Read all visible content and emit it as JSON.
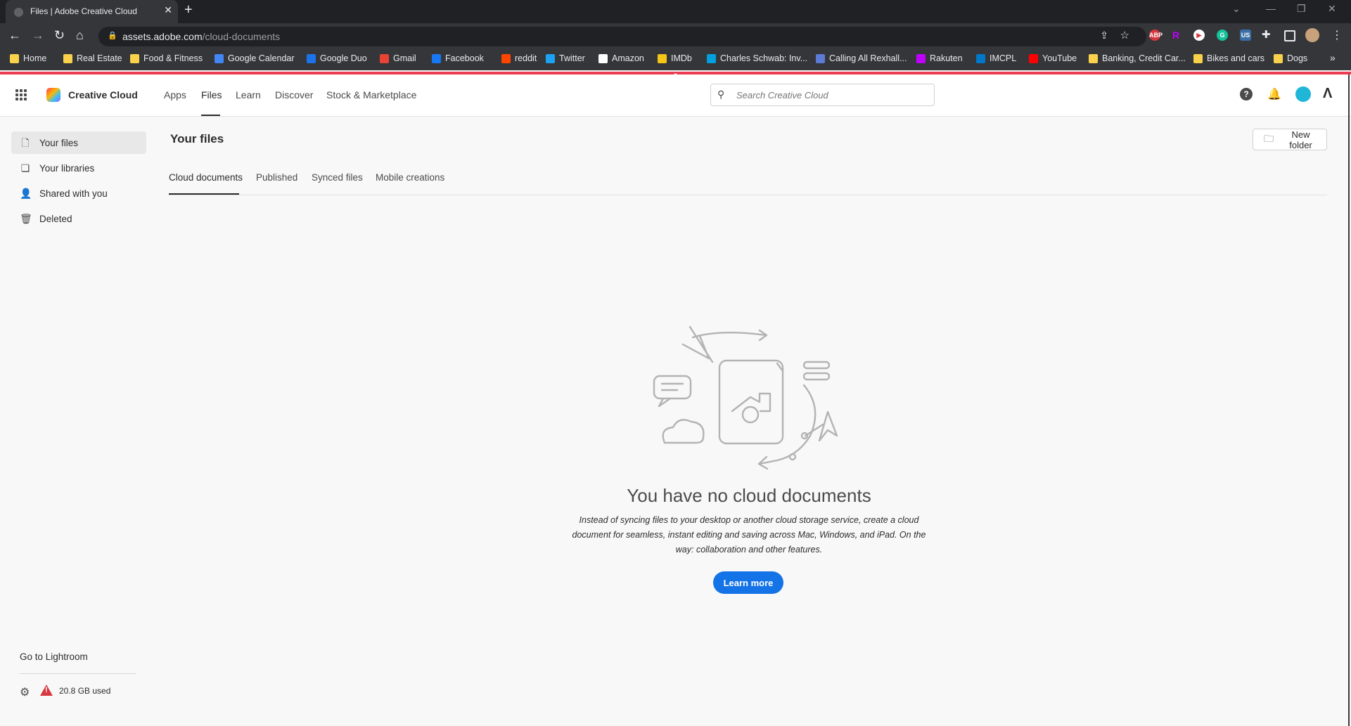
{
  "browser": {
    "tab_title": "Files | Adobe Creative Cloud",
    "url_host": "assets.adobe.com",
    "url_path": "/cloud-documents",
    "bookmarks": [
      {
        "label": "Home",
        "color": "#f9d14b"
      },
      {
        "label": "Real Estate",
        "color": "#f9d14b"
      },
      {
        "label": "Food & Fitness",
        "color": "#f9d14b"
      },
      {
        "label": "Google Calendar",
        "color": "#4285f4"
      },
      {
        "label": "Google Duo",
        "color": "#1a73e8"
      },
      {
        "label": "Gmail",
        "color": "#ea4335"
      },
      {
        "label": "Facebook",
        "color": "#1877f2"
      },
      {
        "label": "reddit",
        "color": "#ff4500"
      },
      {
        "label": "Twitter",
        "color": "#1da1f2"
      },
      {
        "label": "Amazon",
        "color": "#ffffff"
      },
      {
        "label": "IMDb",
        "color": "#f5c518"
      },
      {
        "label": "Charles Schwab: Inv...",
        "color": "#00a0df"
      },
      {
        "label": "Calling All Rexhall...",
        "color": "#5b7bd5"
      },
      {
        "label": "Rakuten",
        "color": "#bf00ff"
      },
      {
        "label": "IMCPL",
        "color": "#0077c8"
      },
      {
        "label": "YouTube",
        "color": "#ff0000"
      },
      {
        "label": "Banking, Credit Car...",
        "color": "#f9d14b"
      },
      {
        "label": "Bikes and cars",
        "color": "#f9d14b"
      },
      {
        "label": "Dogs",
        "color": "#f9d14b"
      }
    ]
  },
  "appbar": {
    "product": "Creative Cloud",
    "nav": [
      "Apps",
      "Files",
      "Learn",
      "Discover",
      "Stock & Marketplace"
    ],
    "active_nav": "Files",
    "search_placeholder": "Search Creative Cloud",
    "accent": "#eb3c52"
  },
  "sidebar": {
    "items": [
      {
        "label": "Your files",
        "icon": "file-icon",
        "selected": true
      },
      {
        "label": "Your libraries",
        "icon": "library-icon",
        "selected": false
      },
      {
        "label": "Shared with you",
        "icon": "people-icon",
        "selected": false
      },
      {
        "label": "Deleted",
        "icon": "trash-icon",
        "selected": false
      }
    ],
    "lightroom_link": "Go to Lightroom",
    "storage": "20.8 GB used"
  },
  "main": {
    "title": "Your files",
    "new_folder": "New folder",
    "tabs": [
      "Cloud documents",
      "Published",
      "Synced files",
      "Mobile creations"
    ],
    "active_tab": "Cloud documents",
    "empty": {
      "title": "You have no cloud documents",
      "body": "Instead of syncing files to your desktop or another cloud storage service, create a cloud document for seamless, instant editing and saving across Mac, Windows, and iPad. On the way: collaboration and other features.",
      "button": "Learn more",
      "button_color": "#1473e6"
    }
  }
}
